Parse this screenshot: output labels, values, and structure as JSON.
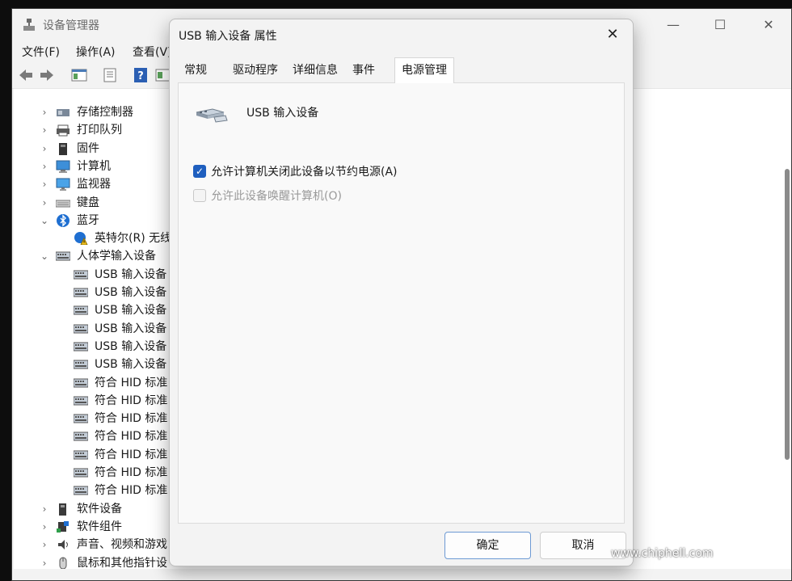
{
  "main_window": {
    "title": "设备管理器",
    "menu": [
      "文件(F)",
      "操作(A)",
      "查看(V)"
    ],
    "tree": [
      {
        "label": "存储控制器",
        "icon": "storage-controller-icon",
        "expanded": false
      },
      {
        "label": "打印队列",
        "icon": "printer-icon",
        "expanded": false
      },
      {
        "label": "固件",
        "icon": "firmware-icon",
        "expanded": false
      },
      {
        "label": "计算机",
        "icon": "computer-icon",
        "expanded": false
      },
      {
        "label": "监视器",
        "icon": "monitor-icon",
        "expanded": false
      },
      {
        "label": "键盘",
        "icon": "keyboard-icon",
        "expanded": false
      },
      {
        "label": "蓝牙",
        "icon": "bluetooth-icon",
        "expanded": true
      },
      {
        "label": "英特尔(R) 无线",
        "icon": "warning-bluetooth-icon",
        "child": true
      },
      {
        "label": "人体学输入设备",
        "icon": "hid-icon",
        "expanded": true
      },
      {
        "label": "USB 输入设备",
        "icon": "hid-icon",
        "child": true
      },
      {
        "label": "USB 输入设备",
        "icon": "hid-icon",
        "child": true
      },
      {
        "label": "USB 输入设备",
        "icon": "hid-icon",
        "child": true
      },
      {
        "label": "USB 输入设备",
        "icon": "hid-icon",
        "child": true
      },
      {
        "label": "USB 输入设备",
        "icon": "hid-icon",
        "child": true
      },
      {
        "label": "USB 输入设备",
        "icon": "hid-icon",
        "child": true
      },
      {
        "label": "符合 HID 标准",
        "icon": "hid-icon",
        "child": true
      },
      {
        "label": "符合 HID 标准",
        "icon": "hid-icon",
        "child": true
      },
      {
        "label": "符合 HID 标准",
        "icon": "hid-icon",
        "child": true
      },
      {
        "label": "符合 HID 标准",
        "icon": "hid-icon",
        "child": true
      },
      {
        "label": "符合 HID 标准",
        "icon": "hid-icon",
        "child": true
      },
      {
        "label": "符合 HID 标准",
        "icon": "hid-icon",
        "child": true
      },
      {
        "label": "符合 HID 标准",
        "icon": "hid-icon",
        "child": true
      },
      {
        "label": "软件设备",
        "icon": "software-device-icon",
        "expanded": false
      },
      {
        "label": "软件组件",
        "icon": "software-component-icon",
        "expanded": false
      },
      {
        "label": "声音、视频和游戏",
        "icon": "speaker-icon",
        "expanded": false
      },
      {
        "label": "鼠标和其他指针设",
        "icon": "mouse-icon",
        "expanded": false
      }
    ]
  },
  "dialog": {
    "title": "USB 输入设备 属性",
    "tabs": [
      "常规",
      "驱动程序",
      "详细信息",
      "事件",
      "电源管理"
    ],
    "active_tab": "电源管理",
    "device_name": "USB 输入设备",
    "options": [
      {
        "label": "允许计算机关闭此设备以节约电源(A)",
        "checked": true,
        "enabled": true
      },
      {
        "label": "允许此设备唤醒计算机(O)",
        "checked": false,
        "enabled": false
      }
    ],
    "ok_label": "确定",
    "cancel_label": "取消"
  },
  "watermark": {
    "url": "www.chiphell.com",
    "logo_text": "chip hell"
  },
  "colors": {
    "accent": "#1f5fbf",
    "window_bg": "#f3f3f3",
    "backdrop": "#0d0d0d"
  }
}
